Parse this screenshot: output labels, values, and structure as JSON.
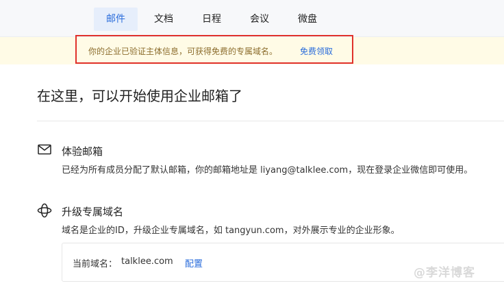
{
  "nav": {
    "tabs": [
      {
        "label": "邮件",
        "active": true
      },
      {
        "label": "文档",
        "active": false
      },
      {
        "label": "日程",
        "active": false
      },
      {
        "label": "会议",
        "active": false
      },
      {
        "label": "微盘",
        "active": false
      }
    ]
  },
  "banner": {
    "text": "你的企业已验证主体信息，可获得免费的专属域名。",
    "link": "免费领取"
  },
  "main": {
    "heading": "在这里，可以开始使用企业邮箱了",
    "sections": [
      {
        "icon": "mail-icon",
        "title": "体验邮箱",
        "desc": "已经为所有成员分配了默认邮箱，你的邮箱地址是 liyang@talklee.com，现在登录企业微信即可使用。"
      },
      {
        "icon": "globe-orbit-icon",
        "title": "升级专属域名",
        "desc": "域名是企业的ID，升级企业专属域名，如 tangyun.com，对外展示专业的企业形象。"
      }
    ],
    "domain": {
      "label": "当前域名：",
      "value": "talklee.com",
      "action": "配置"
    }
  },
  "watermark": "@李洋博客",
  "colors": {
    "accent": "#2a6cdb",
    "banner_bg": "#fffbe6",
    "highlight_border": "#e0312b"
  }
}
